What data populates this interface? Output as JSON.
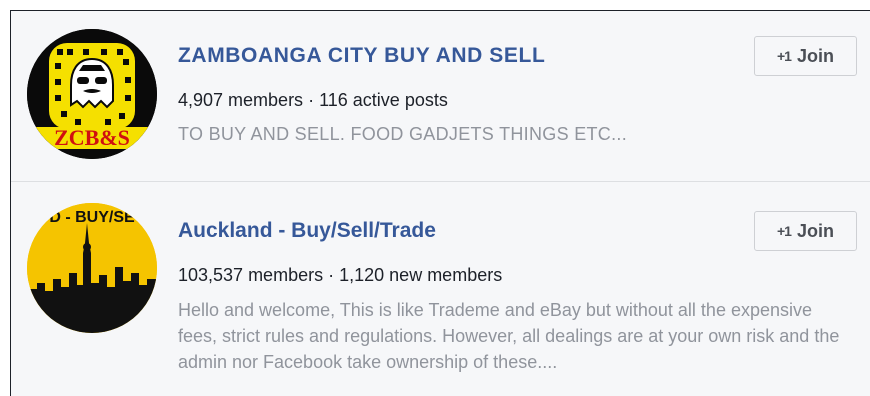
{
  "groups": [
    {
      "title": "ZAMBOANGA CITY BUY AND SELL",
      "members": "4,907 members",
      "separator": "·",
      "activity": "116 active posts",
      "description": "TO BUY AND SELL. FOOD GADJETS THINGS ETC...",
      "avatar_text": "ZCB&S",
      "join_label": "Join",
      "join_icon": "+1",
      "icon_name": "add-member-icon"
    },
    {
      "title": "Auckland - Buy/Sell/Trade",
      "members": "103,537 members",
      "separator": "·",
      "activity": "1,120 new members",
      "description": "Hello and welcome, This is like Trademe and eBay but without all the expensive fees, strict rules and regulations. However, all dealings are at your own risk and the admin nor Facebook take ownership of these....",
      "avatar_text": "D - BUY/SE",
      "join_label": "Join",
      "join_icon": "+1",
      "icon_name": "add-member-icon"
    }
  ],
  "colors": {
    "title": "#365899",
    "muted": "#90949c",
    "text": "#1d2129",
    "yellow": "#f5e000"
  }
}
